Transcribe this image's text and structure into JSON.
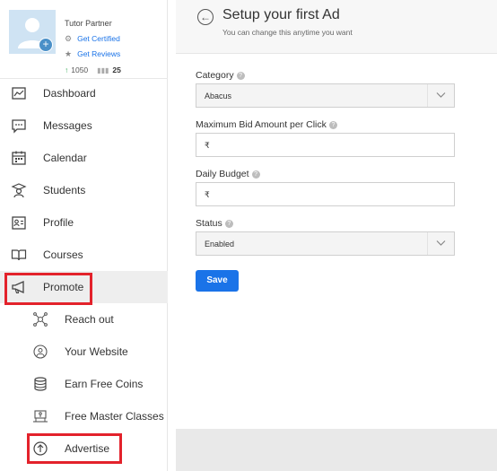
{
  "profile": {
    "name": "Tutor Partner",
    "certified_label": "Get Certified",
    "reviews_label": "Get Reviews",
    "points": "1050",
    "level": "25"
  },
  "nav": {
    "items": [
      {
        "label": "Dashboard",
        "icon": "dashboard-icon"
      },
      {
        "label": "Messages",
        "icon": "messages-icon"
      },
      {
        "label": "Calendar",
        "icon": "calendar-icon"
      },
      {
        "label": "Students",
        "icon": "students-icon"
      },
      {
        "label": "Profile",
        "icon": "profile-icon"
      },
      {
        "label": "Courses",
        "icon": "courses-icon"
      },
      {
        "label": "Promote",
        "icon": "megaphone-icon"
      }
    ],
    "sub_items": [
      {
        "label": "Reach out",
        "icon": "network-icon"
      },
      {
        "label": "Your Website",
        "icon": "website-icon"
      },
      {
        "label": "Earn Free Coins",
        "icon": "coins-icon"
      },
      {
        "label": "Free Master Classes",
        "icon": "classroom-icon"
      },
      {
        "label": "Advertise",
        "icon": "arrow-up-circle-icon"
      }
    ]
  },
  "header": {
    "title": "Setup your first Ad",
    "subtitle": "You can change this anytime you want"
  },
  "form": {
    "category_label": "Category",
    "category_value": "Abacus",
    "max_bid_label": "Maximum Bid Amount per Click",
    "max_bid_value": "₹",
    "daily_budget_label": "Daily Budget",
    "daily_budget_value": "₹",
    "status_label": "Status",
    "status_value": "Enabled",
    "save_label": "Save"
  },
  "colors": {
    "accent": "#1a73e8",
    "highlight": "#e3222b"
  }
}
